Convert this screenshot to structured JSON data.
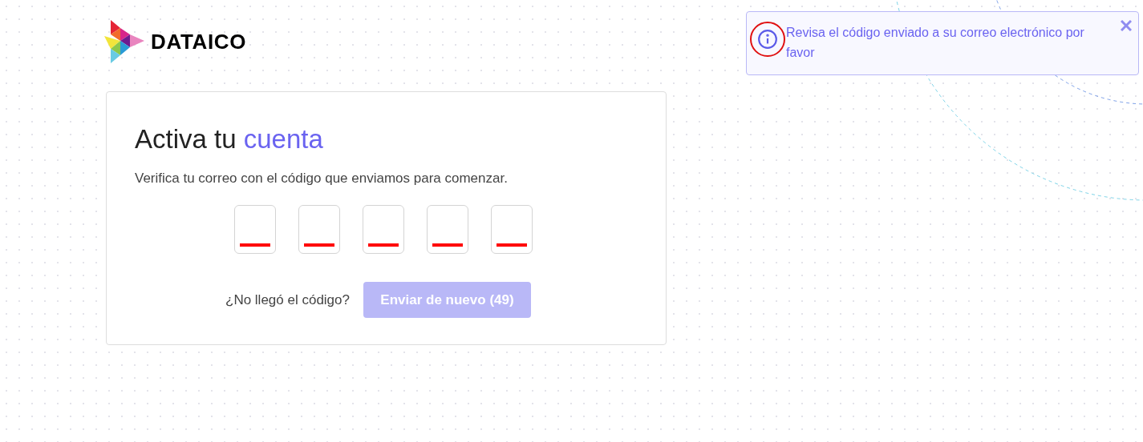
{
  "logo": {
    "text": "DATAICO"
  },
  "card": {
    "title": "Activa tu",
    "title_highlight": "cuenta",
    "subtitle": "Verifica tu correo con el código que enviamos para comenzar.",
    "code_inputs": [
      {
        "invalid": true
      },
      {
        "invalid": true
      },
      {
        "invalid": true
      },
      {
        "invalid": true
      },
      {
        "invalid": true
      }
    ],
    "resend_prompt": "¿No llegó el código?",
    "resend_button": {
      "label": "Enviar de nuevo (49)",
      "disabled": true
    }
  },
  "toast": {
    "message": "Revisa el código enviado a su correo electrónico por favor",
    "highlighted_icon": true
  }
}
